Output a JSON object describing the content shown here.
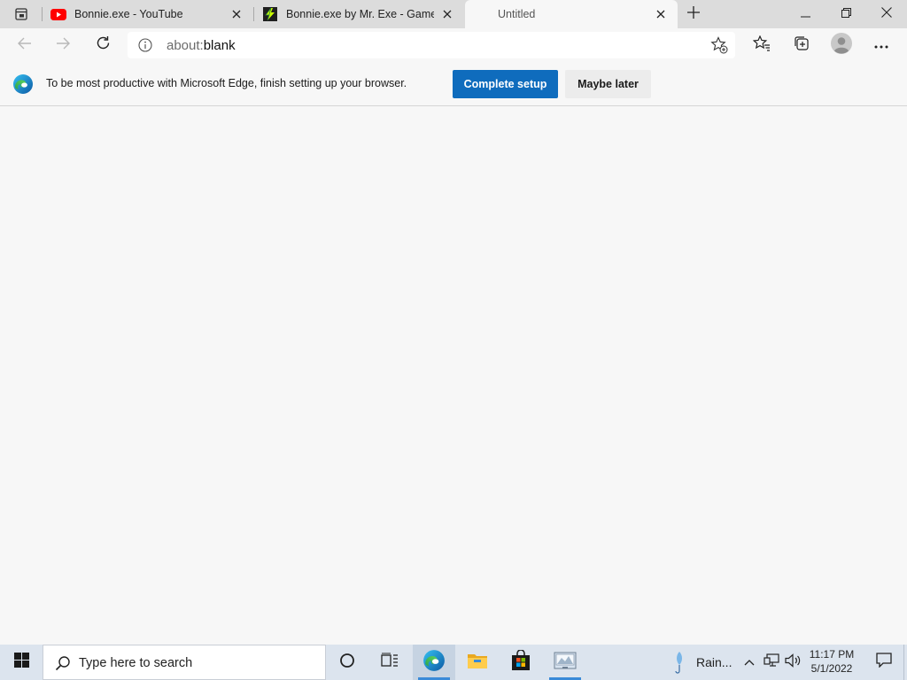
{
  "browser": {
    "tabs": [
      {
        "title": "Bonnie.exe - YouTube",
        "favicon": "youtube-icon",
        "active": false
      },
      {
        "title": "Bonnie.exe by Mr. Exe - Game Jolt",
        "favicon": "gamejolt-icon",
        "active": false
      },
      {
        "title": "Untitled",
        "favicon": "",
        "active": true
      }
    ],
    "address": {
      "scheme": "about:",
      "rest": "blank"
    },
    "accent": "#0f6cbd"
  },
  "infobar": {
    "message": "To be most productive with Microsoft Edge, finish setting up your browser.",
    "primary_label": "Complete setup",
    "secondary_label": "Maybe later"
  },
  "taskbar": {
    "search_placeholder": "Type here to search",
    "weather_label": "Rain...",
    "time": "11:17 PM",
    "date": "5/1/2022",
    "pinned": [
      "edge-icon",
      "file-explorer-icon",
      "store-icon",
      "photos-app-icon"
    ]
  }
}
